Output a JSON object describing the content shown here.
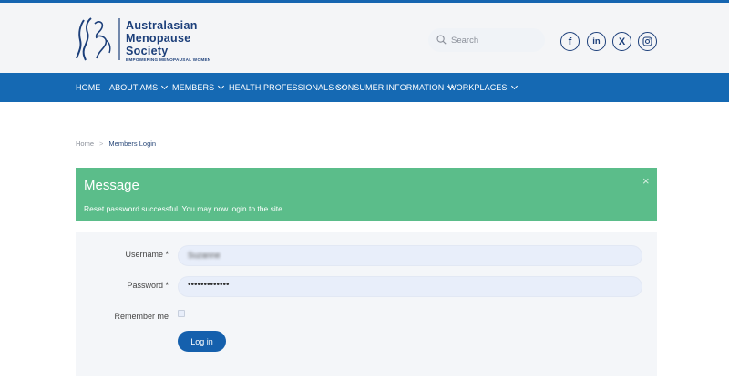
{
  "logo": {
    "line1": "Australasian",
    "line2": "Menopause",
    "line3": "Society",
    "tagline": "EMPOWERING MENOPAUSAL WOMEN"
  },
  "search": {
    "placeholder": "Search"
  },
  "social": {
    "facebook": "f",
    "linkedin": "in",
    "x": "X",
    "instagram_icon": "instagram-icon"
  },
  "nav": {
    "items": [
      {
        "label": "HOME",
        "has_dropdown": false
      },
      {
        "label": "ABOUT AMS",
        "has_dropdown": true
      },
      {
        "label": "MEMBERS",
        "has_dropdown": true
      },
      {
        "label": "HEALTH PROFESSIONALS",
        "has_dropdown": true
      },
      {
        "label": "CONSUMER INFORMATION",
        "has_dropdown": true
      },
      {
        "label": "WORKPLACES",
        "has_dropdown": true
      }
    ]
  },
  "breadcrumb": {
    "home": "Home",
    "separator": ">",
    "current": "Members Login"
  },
  "message": {
    "title": "Message",
    "text": "Reset password successful. You may now login to the site.",
    "close": "×"
  },
  "form": {
    "username_label": "Username *",
    "username_value": "Suzanne",
    "password_label": "Password *",
    "password_value": "•••••••••••••",
    "remember_label": "Remember me",
    "login_label": "Log in"
  },
  "colors": {
    "brand_blue": "#1569b3",
    "logo_navy": "#1c3f7a",
    "success_green": "#5bbd8a"
  }
}
